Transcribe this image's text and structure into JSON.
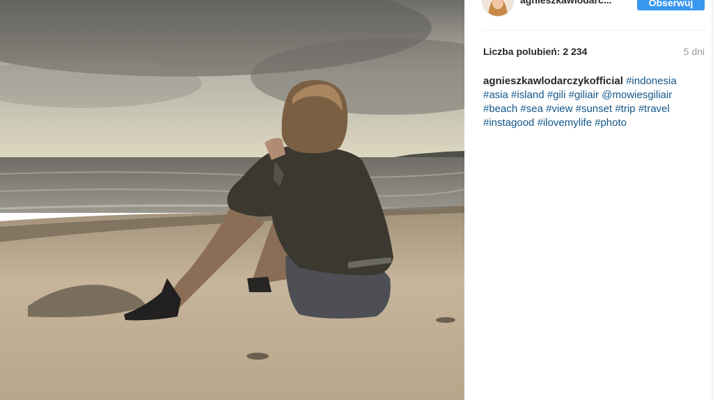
{
  "post": {
    "image_alt": "Woman sitting on a sandy beach looking at the sea under a cloudy sky",
    "author_username": "agnieszkawlodarc...",
    "follow_label": "Obserwuj",
    "likes_text": "Liczba polubień: 2 234",
    "age_text": "5 dni",
    "caption": {
      "author": "agnieszkawlodarczykofficial",
      "tags": [
        "#indonesia",
        "#asia",
        "#island",
        "#gili",
        "#giliair",
        "@mowiesgiliair",
        "#beach",
        "#sea",
        "#view",
        "#sunset",
        "#trip",
        "#travel",
        "#instagood",
        "#ilovemylife",
        "#photo"
      ]
    }
  },
  "colors": {
    "follow_button": "#3897f0",
    "hashtag": "#125688",
    "muted": "#999999"
  }
}
